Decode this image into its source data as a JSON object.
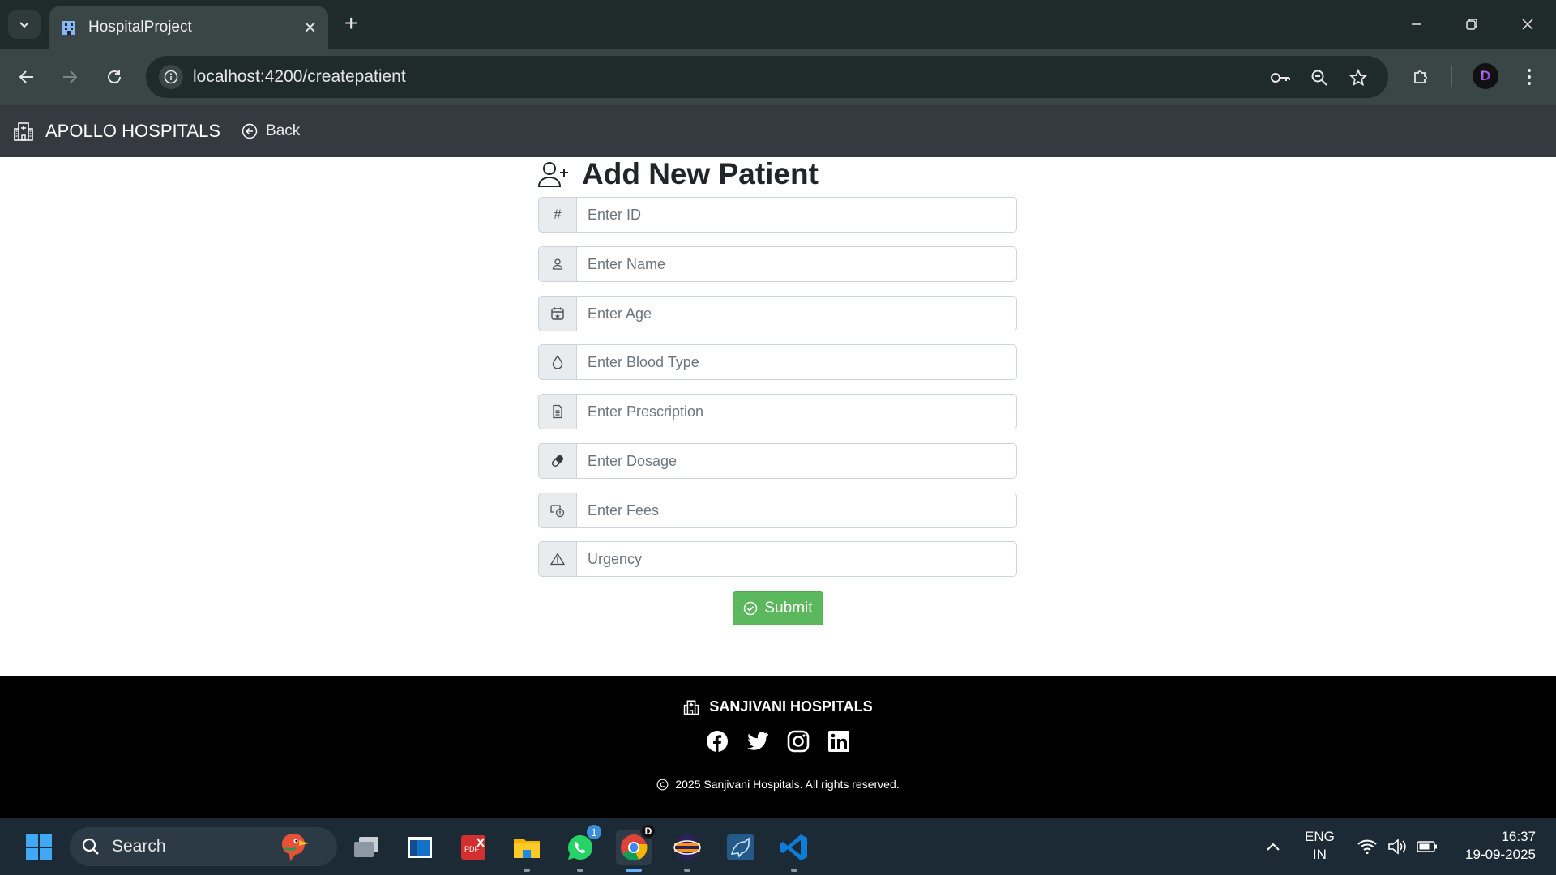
{
  "browser": {
    "tab_title": "HospitalProject",
    "url": "localhost:4200/createpatient"
  },
  "navbar": {
    "brand": "APOLLO HOSPITALS",
    "back_label": "Back"
  },
  "form": {
    "title": "Add New Patient",
    "fields": [
      {
        "icon": "hash-icon",
        "addon_text": "#",
        "placeholder": "Enter ID",
        "value": ""
      },
      {
        "icon": "person-icon",
        "placeholder": "Enter Name",
        "value": ""
      },
      {
        "icon": "calendar-icon",
        "placeholder": "Enter Age",
        "value": ""
      },
      {
        "icon": "droplet-icon",
        "placeholder": "Enter Blood Type",
        "value": ""
      },
      {
        "icon": "document-icon",
        "placeholder": "Enter Prescription",
        "value": ""
      },
      {
        "icon": "capsule-icon",
        "placeholder": "Enter Dosage",
        "value": ""
      },
      {
        "icon": "cash-icon",
        "placeholder": "Enter Fees",
        "value": ""
      },
      {
        "icon": "warning-icon",
        "placeholder": "Urgency",
        "value": ""
      }
    ],
    "submit_label": "Submit",
    "submit_color": "#5cb85c"
  },
  "footer": {
    "brand": "SANJIVANI HOSPITALS",
    "socials": [
      "facebook-icon",
      "twitter-icon",
      "instagram-icon",
      "linkedin-icon"
    ],
    "copyright": "2025 Sanjivani Hospitals. All rights reserved."
  },
  "taskbar": {
    "search_placeholder": "Search",
    "whatsapp_badge": "1",
    "lang_top": "ENG",
    "lang_bottom": "IN",
    "time": "16:37",
    "date": "19-09-2025"
  },
  "colors": {
    "navbar_bg": "#343a40",
    "footer_bg": "#000000",
    "chrome_bg": "#1f2b2b"
  }
}
